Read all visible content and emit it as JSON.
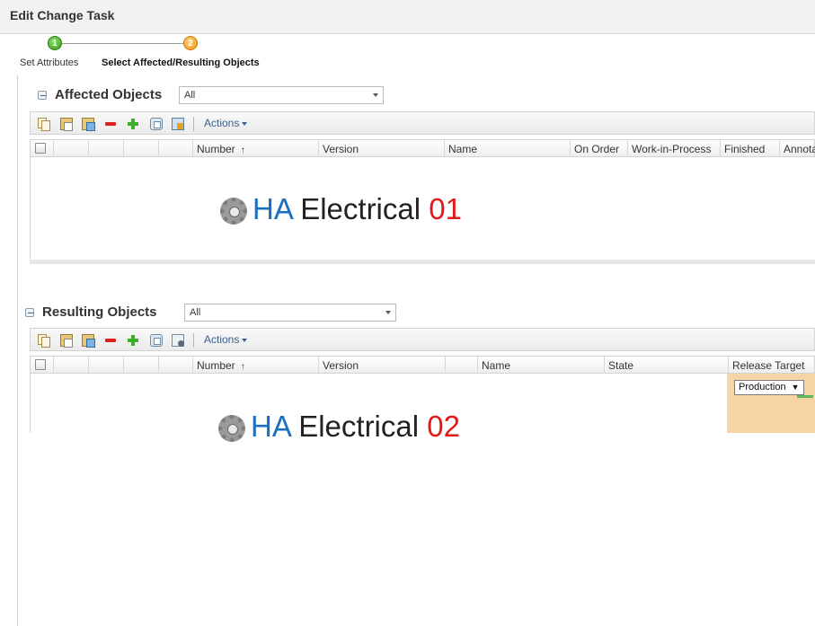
{
  "header": {
    "title": "Edit Change Task"
  },
  "wizard": {
    "steps": [
      {
        "number": "1",
        "label": "Set Attributes",
        "color": "#3a9a1a"
      },
      {
        "number": "2",
        "label": "Select Affected/Resulting Objects",
        "color": "#f0960e"
      }
    ]
  },
  "affected": {
    "title": "Affected Objects",
    "filter_value": "All",
    "actions_label": "Actions",
    "toolbar_icons": [
      "copy-icon",
      "paste-icon",
      "paste-special-icon",
      "remove-icon",
      "add-icon",
      "compare-icon",
      "report-icon"
    ],
    "columns": [
      "Number",
      "Version",
      "Name",
      "On Order",
      "Work-in-Process",
      "Finished",
      "Annota"
    ],
    "watermark": {
      "prefix": "HA",
      "word": "Electrical",
      "number": "01"
    }
  },
  "resulting": {
    "title": "Resulting Objects",
    "filter_value": "All",
    "actions_label": "Actions",
    "toolbar_icons": [
      "copy-icon",
      "paste-icon",
      "paste-special-icon",
      "remove-icon",
      "add-icon",
      "compare-icon",
      "configure-icon"
    ],
    "columns": [
      "Number",
      "Version",
      "Name",
      "State",
      "Release Target"
    ],
    "release_target_value": "Production",
    "release_cell_color": "#f6d4a6",
    "watermark": {
      "prefix": "HA",
      "word": "Electrical",
      "number": "02"
    }
  },
  "sort_indicator": "↑",
  "dropdown_glyph": "▼"
}
